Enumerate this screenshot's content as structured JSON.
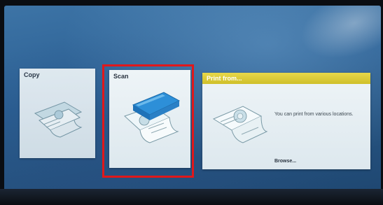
{
  "tiles": {
    "copy": {
      "title": "Copy"
    },
    "scan": {
      "title": "Scan"
    },
    "print": {
      "title": "Print from...",
      "description": "You can print from various locations.",
      "browse_label": "Browse..."
    }
  },
  "colors": {
    "highlight": "#e0181b",
    "print_header": "#dccb36",
    "scanner": "#2d8fd8"
  }
}
